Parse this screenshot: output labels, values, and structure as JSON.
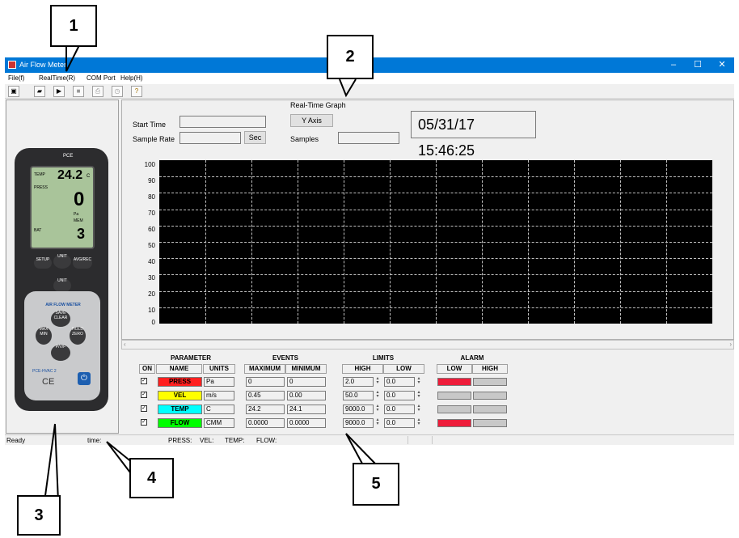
{
  "callouts": [
    "1",
    "2",
    "3",
    "4",
    "5"
  ],
  "window": {
    "title": "Air Flow Meter",
    "controls": {
      "minimize": "–",
      "maximize": "☐",
      "close": "✕"
    }
  },
  "menu": [
    "File(f)",
    "RealTime(R)",
    "COM Port",
    "Help(H)"
  ],
  "toolbar": {
    "icons": [
      "save-icon",
      "open-folder-icon",
      "play-icon",
      "stop-icon",
      "print-icon",
      "clock-icon",
      "help-icon"
    ]
  },
  "graph": {
    "heading": "Real-Time Graph",
    "start_time_label": "Start Time",
    "start_time_value": "",
    "sample_rate_label": "Sample Rate",
    "sample_rate_value": "",
    "sec_button": "Sec",
    "y_axis_button": "Y Axis",
    "samples_label": "Samples",
    "samples_value": "",
    "datetime": "05/31/17 15:46:25",
    "y_ticks": [
      "100",
      "90",
      "80",
      "70",
      "60",
      "50",
      "40",
      "30",
      "20",
      "10",
      "0"
    ],
    "colors": {
      "background": "#000000",
      "grid": "#bfbfbf"
    }
  },
  "device": {
    "logo": "PCE",
    "screen": {
      "temp_label": "TEMP",
      "temp_value": "24.2",
      "temp_unit": "C",
      "press_label": "PRESS",
      "press_value": "0",
      "press_unit": "Pa",
      "mem_label": "MEM",
      "bat_label": "BAT",
      "mem_value": "3"
    },
    "buttons": {
      "setup": "SETUP",
      "unit_up": "UNIT",
      "avg": "AVG/REC",
      "unit_down": "UNIT",
      "save_clear": "SAVE CLEAR",
      "max_min": "MAX MIN",
      "hold_zero": "HOLD ZERO",
      "pvf": "P/V/F"
    },
    "brand_text": "AIR FLOW METER",
    "model": "PCE-HVAC 2",
    "ce_mark": "CE",
    "power_icon": "power-icon"
  },
  "table": {
    "parameter_title": "PARAMETER",
    "events_title": "EVENTS",
    "limits_title": "LIMITS",
    "alarm_title": "ALARM",
    "headers": {
      "on": "ON",
      "name": "NAME",
      "units": "UNITS",
      "maximum": "MAXIMUM",
      "minimum": "MINIMUM",
      "high": "HIGH",
      "low": "LOW",
      "alarm_low": "LOW",
      "alarm_high": "HIGH"
    },
    "rows": [
      {
        "on": "✓",
        "name": "PRESS",
        "color": "#ff2020",
        "units": "Pa",
        "max": "0",
        "min": "0",
        "high": "2.0",
        "low": "0.0",
        "alarm_low": "#ee1c3a",
        "alarm_high": "#c8c8c8"
      },
      {
        "on": "✓",
        "name": "VEL",
        "color": "#ffff00",
        "units": "m/s",
        "max": "0.45",
        "min": "0.00",
        "high": "50.0",
        "low": "0.0",
        "alarm_low": "#c8c8c8",
        "alarm_high": "#c8c8c8"
      },
      {
        "on": "✓",
        "name": "TEMP",
        "color": "#00ffff",
        "units": "C",
        "max": "24.2",
        "min": "24.1",
        "high": "9000.0",
        "low": "0.0",
        "alarm_low": "#c8c8c8",
        "alarm_high": "#c8c8c8"
      },
      {
        "on": "✓",
        "name": "FLOW",
        "color": "#00ff00",
        "units": "CMM",
        "max": "0.0000",
        "min": "0.0000",
        "high": "9000.0",
        "low": "0.0",
        "alarm_low": "#ee1c3a",
        "alarm_high": "#c8c8c8"
      }
    ]
  },
  "status": {
    "ready": "Ready",
    "time": "time:",
    "press": "PRESS:",
    "vel": "VEL:",
    "temp": "TEMP:",
    "flow": "FLOW:"
  }
}
